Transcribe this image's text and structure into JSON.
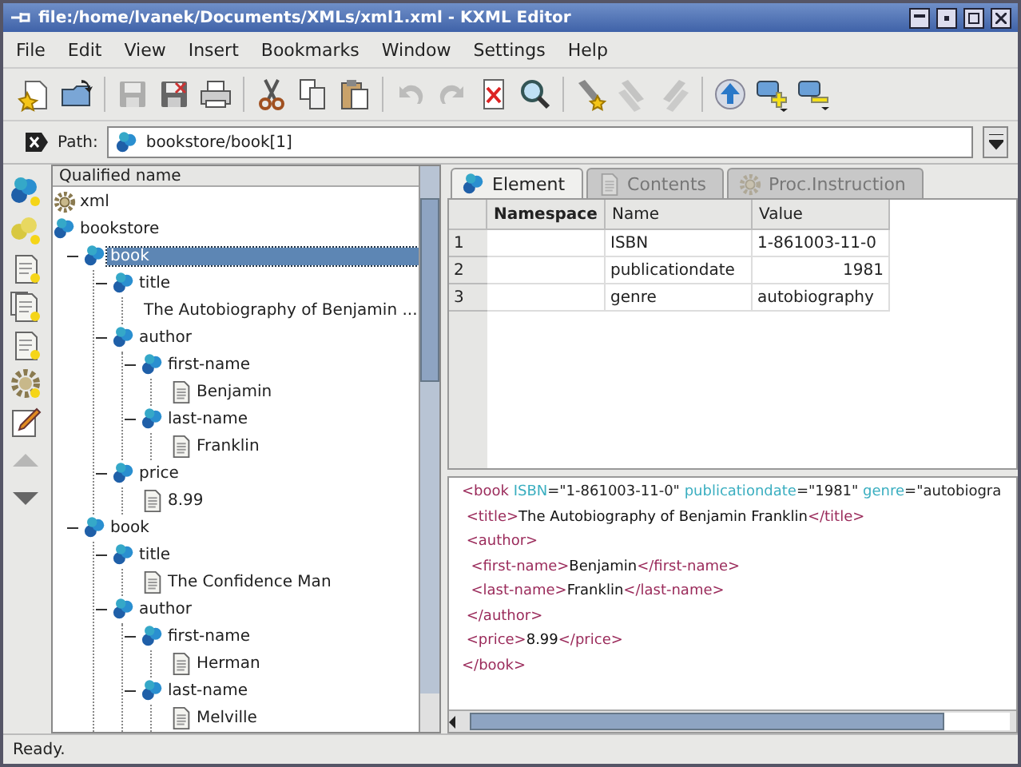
{
  "window": {
    "title": "file:/home/lvanek/Documents/XMLs/xml1.xml - KXML Editor"
  },
  "menu": [
    "File",
    "Edit",
    "View",
    "Insert",
    "Bookmarks",
    "Window",
    "Settings",
    "Help"
  ],
  "toolbar": [
    {
      "kind": "new",
      "disabled": false
    },
    {
      "kind": "open",
      "disabled": false
    },
    {
      "kind": "separator"
    },
    {
      "kind": "save",
      "disabled": true
    },
    {
      "kind": "save-as",
      "disabled": false
    },
    {
      "kind": "print",
      "disabled": false
    },
    {
      "kind": "separator"
    },
    {
      "kind": "cut",
      "disabled": false
    },
    {
      "kind": "copy",
      "disabled": false
    },
    {
      "kind": "paste",
      "disabled": false
    },
    {
      "kind": "separator"
    },
    {
      "kind": "undo",
      "disabled": true
    },
    {
      "kind": "redo",
      "disabled": true
    },
    {
      "kind": "delete",
      "disabled": false
    },
    {
      "kind": "find",
      "disabled": false
    },
    {
      "kind": "separator"
    },
    {
      "kind": "bookmark",
      "disabled": false
    },
    {
      "kind": "bookmark-prev",
      "disabled": true
    },
    {
      "kind": "bookmark-next",
      "disabled": true
    },
    {
      "kind": "separator"
    },
    {
      "kind": "up",
      "disabled": false
    },
    {
      "kind": "add-child",
      "disabled": false
    },
    {
      "kind": "remove-child",
      "disabled": false
    }
  ],
  "path": {
    "label": "Path:",
    "value": "bookstore/book[1]"
  },
  "side_toolbar": [
    {
      "kind": "element",
      "disabled": false
    },
    {
      "kind": "attribute",
      "disabled": false
    },
    {
      "kind": "text",
      "disabled": false
    },
    {
      "kind": "cdata",
      "disabled": false
    },
    {
      "kind": "comment",
      "disabled": false
    },
    {
      "kind": "proc",
      "disabled": false
    },
    {
      "kind": "edit",
      "disabled": false
    },
    {
      "kind": "move-up",
      "disabled": true
    },
    {
      "kind": "move-down",
      "disabled": false
    }
  ],
  "tree": {
    "header": "Qualified name",
    "nodes": [
      {
        "kind": "proc",
        "name": "xml",
        "selected": false
      },
      {
        "kind": "element",
        "name": "bookstore",
        "selected": false,
        "children": [
          {
            "kind": "element",
            "name": "book",
            "selected": true,
            "expanded": true,
            "children": [
              {
                "kind": "element",
                "name": "title",
                "selected": false,
                "expanded": true,
                "children": [
                  {
                    "kind": "text",
                    "name": "The Autobiography of Benjamin ...",
                    "selected": false
                  }
                ]
              },
              {
                "kind": "element",
                "name": "author",
                "selected": false,
                "expanded": true,
                "children": [
                  {
                    "kind": "element",
                    "name": "first-name",
                    "selected": false,
                    "expanded": true,
                    "children": [
                      {
                        "kind": "text",
                        "name": "Benjamin",
                        "selected": false
                      }
                    ]
                  },
                  {
                    "kind": "element",
                    "name": "last-name",
                    "selected": false,
                    "expanded": true,
                    "children": [
                      {
                        "kind": "text",
                        "name": "Franklin",
                        "selected": false
                      }
                    ]
                  }
                ]
              },
              {
                "kind": "element",
                "name": "price",
                "selected": false,
                "expanded": true,
                "children": [
                  {
                    "kind": "text",
                    "name": "8.99",
                    "selected": false
                  }
                ]
              }
            ]
          },
          {
            "kind": "element",
            "name": "book",
            "selected": false,
            "expanded": true,
            "children": [
              {
                "kind": "element",
                "name": "title",
                "selected": false,
                "expanded": true,
                "children": [
                  {
                    "kind": "text",
                    "name": "The Confidence Man",
                    "selected": false
                  }
                ]
              },
              {
                "kind": "element",
                "name": "author",
                "selected": false,
                "expanded": true,
                "children": [
                  {
                    "kind": "element",
                    "name": "first-name",
                    "selected": false,
                    "expanded": true,
                    "children": [
                      {
                        "kind": "text",
                        "name": "Herman",
                        "selected": false
                      }
                    ]
                  },
                  {
                    "kind": "element",
                    "name": "last-name",
                    "selected": false,
                    "expanded": true,
                    "children": [
                      {
                        "kind": "text",
                        "name": "Melville",
                        "selected": false
                      }
                    ]
                  }
                ]
              }
            ]
          }
        ]
      }
    ]
  },
  "tabs": [
    {
      "label": "Element",
      "kind": "element",
      "selected": true,
      "disabled": false
    },
    {
      "label": "Contents",
      "kind": "text",
      "selected": false,
      "disabled": true
    },
    {
      "label": "Proc.Instruction",
      "kind": "proc",
      "selected": false,
      "disabled": true
    }
  ],
  "attributes": {
    "columns": [
      {
        "label": "Namespace",
        "sorted": true
      },
      {
        "label": "Name",
        "sorted": false
      },
      {
        "label": "Value",
        "sorted": false
      }
    ],
    "rows": [
      {
        "number": "1",
        "name": "ISBN",
        "value": "1-861003-11-0",
        "numeric": false
      },
      {
        "number": "2",
        "name": "publicationdate",
        "value": "1981",
        "numeric": true
      },
      {
        "number": "3",
        "name": "genre",
        "value": "autobiography",
        "numeric": false
      }
    ]
  },
  "source": {
    "lines": [
      [
        {
          "kind": "tag",
          "text": "<book"
        },
        {
          "kind": "attr",
          "text": " ISBN"
        },
        {
          "kind": "value",
          "text": "=\"1-861003-11-0\""
        },
        {
          "kind": "attr",
          "text": " publicationdate"
        },
        {
          "kind": "value",
          "text": "=\"1981\""
        },
        {
          "kind": "attr",
          "text": " genre"
        },
        {
          "kind": "value",
          "text": "=\"autobiogra"
        }
      ],
      [
        {
          "kind": "tag",
          "text": " <title>"
        },
        {
          "kind": "text",
          "text": "The Autobiography of Benjamin Franklin"
        },
        {
          "kind": "tag",
          "text": "</title>"
        }
      ],
      [
        {
          "kind": "tag",
          "text": " <author>"
        }
      ],
      [
        {
          "kind": "tag",
          "text": "  <first-name>"
        },
        {
          "kind": "text",
          "text": "Benjamin"
        },
        {
          "kind": "tag",
          "text": "</first-name>"
        }
      ],
      [
        {
          "kind": "tag",
          "text": "  <last-name>"
        },
        {
          "kind": "text",
          "text": "Franklin"
        },
        {
          "kind": "tag",
          "text": "</last-name>"
        }
      ],
      [
        {
          "kind": "tag",
          "text": " </author>"
        }
      ],
      [
        {
          "kind": "tag",
          "text": " <price>"
        },
        {
          "kind": "text",
          "text": "8.99"
        },
        {
          "kind": "tag",
          "text": "</price>"
        }
      ],
      [
        {
          "kind": "tag",
          "text": "</book>"
        }
      ]
    ]
  },
  "status_bar": "Ready."
}
